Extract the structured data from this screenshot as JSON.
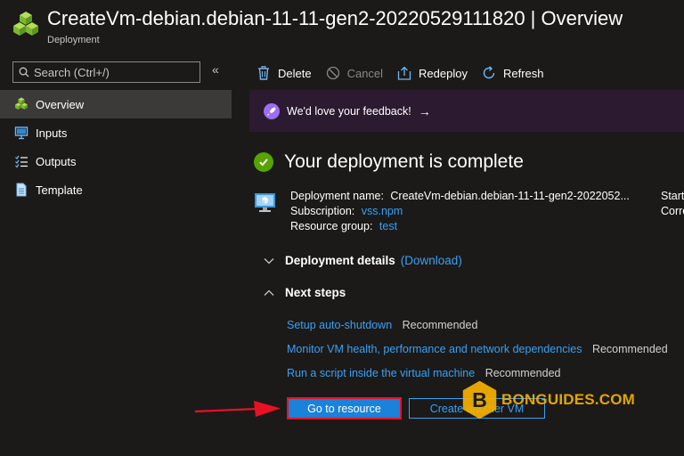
{
  "header": {
    "title": "CreateVm-debian.debian-11-11-gen2-20220529111820 | Overview",
    "subtitle": "Deployment"
  },
  "sidebar": {
    "search_placeholder": "Search (Ctrl+/)",
    "collapse_glyph": "«",
    "items": [
      {
        "label": "Overview",
        "icon": "deployment-cubes-icon",
        "active": true
      },
      {
        "label": "Inputs",
        "icon": "inputs-icon"
      },
      {
        "label": "Outputs",
        "icon": "outputs-list-icon"
      },
      {
        "label": "Template",
        "icon": "template-document-icon"
      }
    ]
  },
  "toolbar": {
    "delete_label": "Delete",
    "cancel_label": "Cancel",
    "redeploy_label": "Redeploy",
    "refresh_label": "Refresh"
  },
  "feedback": {
    "text": "We'd love your feedback!",
    "arrow": "→"
  },
  "status": {
    "text": "Your deployment is complete"
  },
  "details": {
    "deployment_name_label": "Deployment name:",
    "deployment_name": "CreateVm-debian.debian-11-11-gen2-2022052...",
    "subscription_label": "Subscription:",
    "subscription": "vss.npm",
    "resource_group_label": "Resource group:",
    "resource_group": "test",
    "right_col_line1": "Start",
    "right_col_line2": "Corre"
  },
  "sections": {
    "deployment_details": "Deployment details",
    "download": "(Download)",
    "next_steps": "Next steps"
  },
  "next_steps": [
    {
      "link": "Setup auto-shutdown",
      "tag": "Recommended"
    },
    {
      "link": "Monitor VM health, performance and network dependencies",
      "tag": "Recommended"
    },
    {
      "link": "Run a script inside the virtual machine",
      "tag": "Recommended"
    }
  ],
  "buttons": {
    "go_to_resource": "Go to resource",
    "create_another": "Create another VM"
  },
  "watermark": {
    "text": "BONGUIDES.COM",
    "letter": "B"
  },
  "colors": {
    "accent": "#3aa0f3",
    "primary_button": "#1a82d8",
    "highlight_border": "#e81123",
    "success": "#57a300",
    "feedback_banner": "#2c1a30"
  }
}
